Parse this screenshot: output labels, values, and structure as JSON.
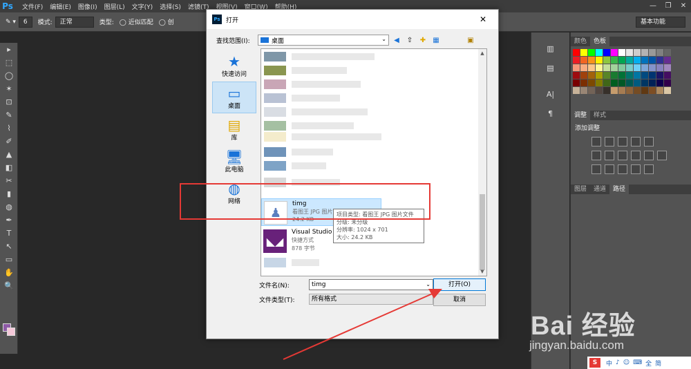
{
  "photoshop": {
    "logo": "Ps",
    "menus": [
      "文件(F)",
      "编辑(E)",
      "图像(I)",
      "图层(L)",
      "文字(Y)",
      "选择(S)",
      "滤镜(T)",
      "视图(V)",
      "窗口(W)",
      "帮助(H)"
    ],
    "window_controls": [
      "—",
      "❐",
      "✕"
    ],
    "options": {
      "brush_size": "6",
      "mode_label": "模式:",
      "mode_value": "正常",
      "type_label": "类型:",
      "type_option1": "近似匹配",
      "type_option2": "创"
    },
    "workspace": "基本功能",
    "tools": [
      "▸",
      "⬚",
      "◯",
      "✶",
      "⊡",
      "✎",
      "⌇",
      "✐",
      "▲",
      "◧",
      "✂",
      "▮",
      "◍",
      "✒",
      "T",
      "↖",
      "▭",
      "✋",
      "🔍"
    ],
    "mini_panel": [
      "▥",
      "▤",
      "A|",
      "¶"
    ]
  },
  "swatches": {
    "tabs": [
      "颜色",
      "色板"
    ],
    "active_tab": "色板",
    "colors": [
      "#ff0000",
      "#ffff00",
      "#00ff00",
      "#00ffff",
      "#0000ff",
      "#ff00ff",
      "#ffffff",
      "#e6e6e6",
      "#cccccc",
      "#b3b3b3",
      "#999999",
      "#808080",
      "#666666",
      "#ed1c24",
      "#f26522",
      "#f7941d",
      "#fff200",
      "#8dc63f",
      "#39b54a",
      "#00a651",
      "#00a99d",
      "#00aeef",
      "#0072bc",
      "#0054a6",
      "#2e3192",
      "#662d91",
      "#f7977a",
      "#f9ad81",
      "#fdc68a",
      "#fff79a",
      "#c4df9b",
      "#a3d39c",
      "#82ca9d",
      "#7bcdc8",
      "#6ecff6",
      "#7ea7d8",
      "#8493ca",
      "#8882be",
      "#a187be",
      "#9e0b0f",
      "#a0410d",
      "#a3620a",
      "#aba000",
      "#598527",
      "#197b30",
      "#007236",
      "#00746b",
      "#0076a3",
      "#004a80",
      "#003471",
      "#1b1464",
      "#440e62",
      "#790000",
      "#7b2e00",
      "#7d4900",
      "#827b00",
      "#406618",
      "#005e20",
      "#005826",
      "#005952",
      "#005b7f",
      "#003663",
      "#002157",
      "#0d004c",
      "#32004b",
      "#c7b299",
      "#998675",
      "#736357",
      "#534741",
      "#37302a",
      "#c69c6d",
      "#a67c52",
      "#8c6239",
      "#754c24",
      "#603913",
      "#7d4e24",
      "#ad8a5f",
      "#dbc8a6"
    ]
  },
  "adjustments": {
    "tabs": [
      "调整",
      "样式"
    ],
    "title": "添加调整"
  },
  "layers": {
    "tabs": [
      "图层",
      "通道",
      "路径"
    ],
    "active_tab": "路径"
  },
  "dialog": {
    "title": "打开",
    "lookin_label": "查找范围(I):",
    "lookin_value": "桌面",
    "places": [
      {
        "label": "快速访问",
        "icon": "★"
      },
      {
        "label": "桌面",
        "icon": "▭"
      },
      {
        "label": "库",
        "icon": "▤"
      },
      {
        "label": "此电脑",
        "icon": "🖥"
      },
      {
        "label": "网络",
        "icon": "◍"
      }
    ],
    "selected_file": {
      "name": "timg",
      "type": "看图王 JPG 图片文件",
      "size": "24.2 KB"
    },
    "other_file": {
      "name": "Visual Studio 2",
      "type": "快捷方式",
      "size": "878 字节"
    },
    "tooltip": {
      "item_type": "项目类型: 看图王 JPG 图片文件",
      "rating": "分级: 未分级",
      "resolution": "分辨率: 1024 x 701",
      "size": "大小: 24.2 KB"
    },
    "filename_label": "文件名(N):",
    "filename_value": "timg",
    "filetype_label": "文件类型(T):",
    "filetype_value": "所有格式",
    "open_button": "打开(O)",
    "cancel_button": "取消"
  },
  "watermark": {
    "main": "Bai  经验",
    "sub": "jingyan.baidu.com"
  },
  "ime": {
    "logo": "S",
    "items": [
      "中",
      "♪",
      "☺",
      "⌨",
      "全",
      "简"
    ]
  }
}
